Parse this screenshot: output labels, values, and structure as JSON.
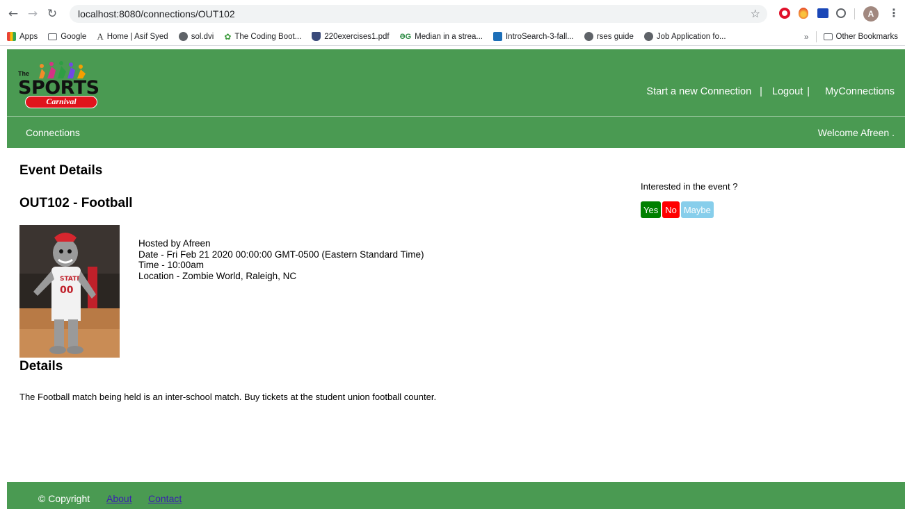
{
  "browser": {
    "url": "localhost:8080/connections/OUT102",
    "avatar_letter": "A",
    "bookmarks": [
      {
        "label": "Apps",
        "icon": "apps-icon"
      },
      {
        "label": "Google",
        "icon": "folder-icon"
      },
      {
        "label": "Home | Asif Syed",
        "icon": "a-icon"
      },
      {
        "label": "sol.dvi",
        "icon": "globe-icon"
      },
      {
        "label": "The Coding Boot...",
        "icon": "leaf-icon"
      },
      {
        "label": "220exercises1.pdf",
        "icon": "shield-icon"
      },
      {
        "label": "Median in a strea...",
        "icon": "gfg-icon"
      },
      {
        "label": "IntroSearch-3-fall...",
        "icon": "uci-icon"
      },
      {
        "label": "rses guide",
        "icon": "globe-icon"
      },
      {
        "label": "Job Application fo...",
        "icon": "globe-icon"
      }
    ],
    "bookmarks_overflow": "»",
    "other_bookmarks": "Other Bookmarks"
  },
  "header": {
    "logo": {
      "the": "The",
      "sports": "SPORTS",
      "carnival": "Carnival"
    },
    "nav": {
      "new_connection": "Start a new Connection",
      "sep1": "|",
      "logout": "Logout",
      "sep2": "|",
      "my_connections": "MyConnections"
    },
    "subnav_left": "Connections",
    "welcome": "Welcome Afreen ."
  },
  "event": {
    "section_title": "Event Details",
    "title": "OUT102 - Football",
    "hosted_by": "Hosted by Afreen",
    "date": "Date - Fri Feb 21 2020 00:00:00 GMT-0500 (Eastern Standard Time)",
    "time": "Time - 10:00am",
    "location": "Location - Zombie World, Raleigh, NC",
    "details_title": "Details",
    "description": "The Football match being held is an inter-school match. Buy tickets at the student union football counter."
  },
  "rsvp": {
    "question": "Interested in the event ?",
    "yes": "Yes",
    "no": "No",
    "maybe": "Maybe",
    "colors": {
      "yes": "#008000",
      "no": "#ff0000",
      "maybe": "#87ceeb"
    }
  },
  "footer": {
    "copyright": "© Copyright",
    "about": "About",
    "contact": "Contact"
  },
  "theme": {
    "header_green": "#4a9a52"
  }
}
